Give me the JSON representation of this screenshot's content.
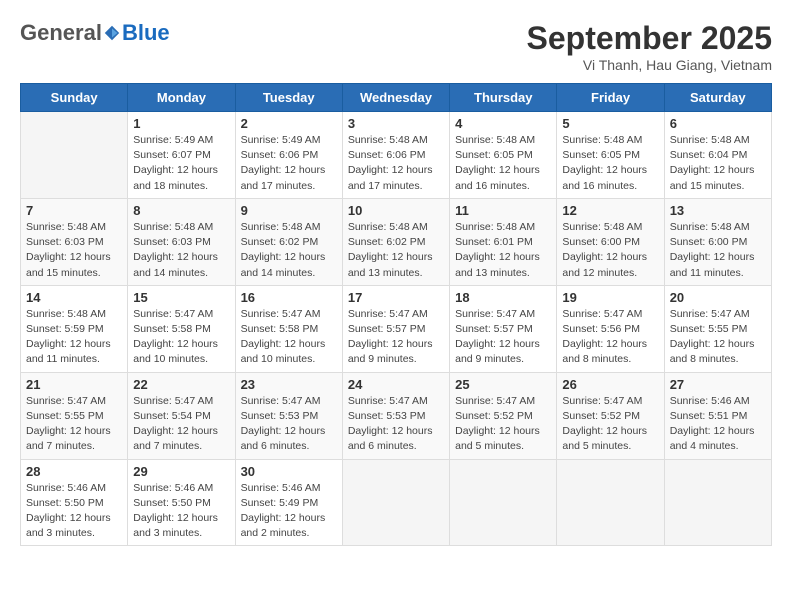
{
  "logo": {
    "general": "General",
    "blue": "Blue"
  },
  "title": "September 2025",
  "location": "Vi Thanh, Hau Giang, Vietnam",
  "days_of_week": [
    "Sunday",
    "Monday",
    "Tuesday",
    "Wednesday",
    "Thursday",
    "Friday",
    "Saturday"
  ],
  "weeks": [
    [
      {
        "day": "",
        "info": ""
      },
      {
        "day": "1",
        "info": "Sunrise: 5:49 AM\nSunset: 6:07 PM\nDaylight: 12 hours\nand 18 minutes."
      },
      {
        "day": "2",
        "info": "Sunrise: 5:49 AM\nSunset: 6:06 PM\nDaylight: 12 hours\nand 17 minutes."
      },
      {
        "day": "3",
        "info": "Sunrise: 5:48 AM\nSunset: 6:06 PM\nDaylight: 12 hours\nand 17 minutes."
      },
      {
        "day": "4",
        "info": "Sunrise: 5:48 AM\nSunset: 6:05 PM\nDaylight: 12 hours\nand 16 minutes."
      },
      {
        "day": "5",
        "info": "Sunrise: 5:48 AM\nSunset: 6:05 PM\nDaylight: 12 hours\nand 16 minutes."
      },
      {
        "day": "6",
        "info": "Sunrise: 5:48 AM\nSunset: 6:04 PM\nDaylight: 12 hours\nand 15 minutes."
      }
    ],
    [
      {
        "day": "7",
        "info": "Sunrise: 5:48 AM\nSunset: 6:03 PM\nDaylight: 12 hours\nand 15 minutes."
      },
      {
        "day": "8",
        "info": "Sunrise: 5:48 AM\nSunset: 6:03 PM\nDaylight: 12 hours\nand 14 minutes."
      },
      {
        "day": "9",
        "info": "Sunrise: 5:48 AM\nSunset: 6:02 PM\nDaylight: 12 hours\nand 14 minutes."
      },
      {
        "day": "10",
        "info": "Sunrise: 5:48 AM\nSunset: 6:02 PM\nDaylight: 12 hours\nand 13 minutes."
      },
      {
        "day": "11",
        "info": "Sunrise: 5:48 AM\nSunset: 6:01 PM\nDaylight: 12 hours\nand 13 minutes."
      },
      {
        "day": "12",
        "info": "Sunrise: 5:48 AM\nSunset: 6:00 PM\nDaylight: 12 hours\nand 12 minutes."
      },
      {
        "day": "13",
        "info": "Sunrise: 5:48 AM\nSunset: 6:00 PM\nDaylight: 12 hours\nand 11 minutes."
      }
    ],
    [
      {
        "day": "14",
        "info": "Sunrise: 5:48 AM\nSunset: 5:59 PM\nDaylight: 12 hours\nand 11 minutes."
      },
      {
        "day": "15",
        "info": "Sunrise: 5:47 AM\nSunset: 5:58 PM\nDaylight: 12 hours\nand 10 minutes."
      },
      {
        "day": "16",
        "info": "Sunrise: 5:47 AM\nSunset: 5:58 PM\nDaylight: 12 hours\nand 10 minutes."
      },
      {
        "day": "17",
        "info": "Sunrise: 5:47 AM\nSunset: 5:57 PM\nDaylight: 12 hours\nand 9 minutes."
      },
      {
        "day": "18",
        "info": "Sunrise: 5:47 AM\nSunset: 5:57 PM\nDaylight: 12 hours\nand 9 minutes."
      },
      {
        "day": "19",
        "info": "Sunrise: 5:47 AM\nSunset: 5:56 PM\nDaylight: 12 hours\nand 8 minutes."
      },
      {
        "day": "20",
        "info": "Sunrise: 5:47 AM\nSunset: 5:55 PM\nDaylight: 12 hours\nand 8 minutes."
      }
    ],
    [
      {
        "day": "21",
        "info": "Sunrise: 5:47 AM\nSunset: 5:55 PM\nDaylight: 12 hours\nand 7 minutes."
      },
      {
        "day": "22",
        "info": "Sunrise: 5:47 AM\nSunset: 5:54 PM\nDaylight: 12 hours\nand 7 minutes."
      },
      {
        "day": "23",
        "info": "Sunrise: 5:47 AM\nSunset: 5:53 PM\nDaylight: 12 hours\nand 6 minutes."
      },
      {
        "day": "24",
        "info": "Sunrise: 5:47 AM\nSunset: 5:53 PM\nDaylight: 12 hours\nand 6 minutes."
      },
      {
        "day": "25",
        "info": "Sunrise: 5:47 AM\nSunset: 5:52 PM\nDaylight: 12 hours\nand 5 minutes."
      },
      {
        "day": "26",
        "info": "Sunrise: 5:47 AM\nSunset: 5:52 PM\nDaylight: 12 hours\nand 5 minutes."
      },
      {
        "day": "27",
        "info": "Sunrise: 5:46 AM\nSunset: 5:51 PM\nDaylight: 12 hours\nand 4 minutes."
      }
    ],
    [
      {
        "day": "28",
        "info": "Sunrise: 5:46 AM\nSunset: 5:50 PM\nDaylight: 12 hours\nand 3 minutes."
      },
      {
        "day": "29",
        "info": "Sunrise: 5:46 AM\nSunset: 5:50 PM\nDaylight: 12 hours\nand 3 minutes."
      },
      {
        "day": "30",
        "info": "Sunrise: 5:46 AM\nSunset: 5:49 PM\nDaylight: 12 hours\nand 2 minutes."
      },
      {
        "day": "",
        "info": ""
      },
      {
        "day": "",
        "info": ""
      },
      {
        "day": "",
        "info": ""
      },
      {
        "day": "",
        "info": ""
      }
    ]
  ]
}
